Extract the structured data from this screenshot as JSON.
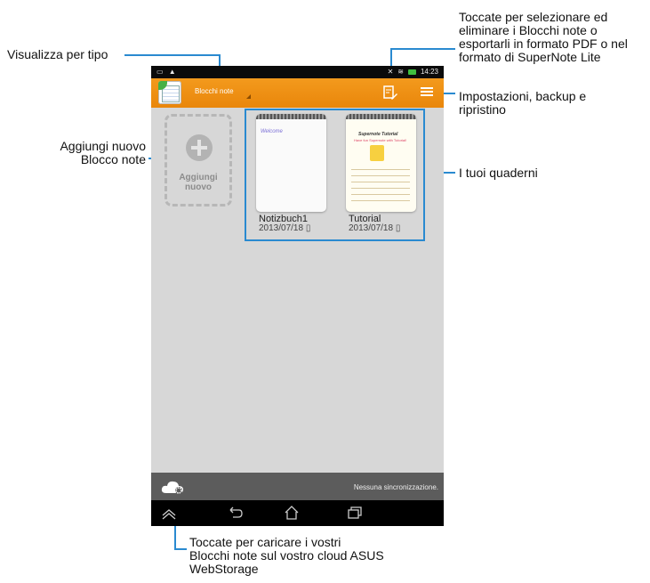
{
  "callouts": {
    "view_by_type": "Visualizza per tipo",
    "select_line1": "Toccate per selezionare ed",
    "select_line2": "eliminare i Blocchi note o",
    "select_line3": "esportarli in formato PDF o nel",
    "select_line4": "formato di SuperNote Lite",
    "settings_line1": "Impostazioni, backup e",
    "settings_line2": "ripristino",
    "add_line1": "Aggiungi nuovo",
    "add_line2": "Blocco note",
    "notebooks": "I tuoi quaderni",
    "upload_line1": "Toccate per caricare i vostri",
    "upload_line2": "Blocchi note sul vostro cloud ASUS",
    "upload_line3": "WebStorage"
  },
  "status_bar": {
    "time": "14:23"
  },
  "action_bar": {
    "type_dropdown_label": "Blocchi note"
  },
  "add_tile": {
    "label_line1": "Aggiungi",
    "label_line2": "nuovo"
  },
  "notebooks": [
    {
      "name": "Notizbuch1",
      "date": "2013/07/18",
      "cover_text": "Welcome"
    },
    {
      "name": "Tutorial",
      "date": "2013/07/18",
      "cover_title": "Supernote Tutorial",
      "cover_subtitle": "Have fun Supernote with Tutorial!"
    }
  ],
  "sync_bar": {
    "status": "Nessuna sincronizzazione."
  },
  "colors": {
    "accent": "#f39a1d",
    "callout_line": "#2a8ad0"
  }
}
